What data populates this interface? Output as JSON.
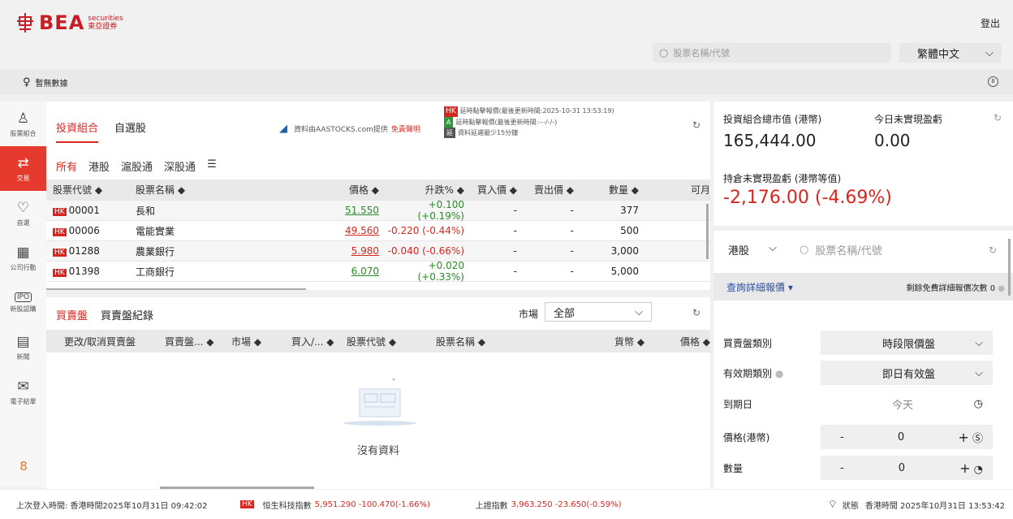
{
  "header": {
    "brand": "BEA",
    "brand_sub_en": "securities",
    "brand_sub_zh": "東亞證券",
    "logout": "登出",
    "search_placeholder": "股票名稱/代號",
    "language": "繁體中文"
  },
  "notice": {
    "text": "暫無數據"
  },
  "sidebar": {
    "items": [
      {
        "label": "股票組合",
        "icon": "person-icon"
      },
      {
        "label": "交易",
        "icon": "swap-arrows-icon"
      },
      {
        "label": "自選",
        "icon": "heart-icon"
      },
      {
        "label": "公司行動",
        "icon": "building-icon"
      },
      {
        "label": "新股認購",
        "icon": "ipo-icon"
      },
      {
        "label": "新聞",
        "icon": "news-icon"
      },
      {
        "label": "電子結單",
        "icon": "statement-icon"
      }
    ],
    "badge": "8"
  },
  "portfolio": {
    "tabs": [
      "投資組合",
      "自選股"
    ],
    "source": "資料由AASTOCKS.com提供",
    "disclaimer": "免責聲明",
    "delay_lines": [
      {
        "tag": "HK",
        "text": "延時點擊報價(最後更新時間:2025-10-31 13:53:19)"
      },
      {
        "tag": "A",
        "text": "延時點擊報價(最後更新時間:---/-/-)"
      },
      {
        "tag": "延",
        "text": "資料延遲最少15分鐘"
      }
    ],
    "market_tabs": [
      "所有",
      "港股",
      "滬股通",
      "深股通"
    ],
    "columns": [
      "股票代號 ◆",
      "股票名稱 ◆",
      "價格 ◆",
      "升跌% ◆",
      "買入價 ◆",
      "賣出價 ◆",
      "數量 ◆",
      "可月"
    ],
    "rows": [
      {
        "market": "HK",
        "code": "00001",
        "name": "長和",
        "price": "51.550",
        "change": "+0.100 (+0.19%)",
        "bid": "-",
        "ask": "-",
        "qty": "377",
        "dir": "up"
      },
      {
        "market": "HK",
        "code": "00006",
        "name": "電能實業",
        "price": "49.560",
        "change": "-0.220 (-0.44%)",
        "bid": "-",
        "ask": "-",
        "qty": "500",
        "dir": "dn"
      },
      {
        "market": "HK",
        "code": "01288",
        "name": "農業銀行",
        "price": "5.980",
        "change": "-0.040 (-0.66%)",
        "bid": "-",
        "ask": "-",
        "qty": "3,000",
        "dir": "dn"
      },
      {
        "market": "HK",
        "code": "01398",
        "name": "工商銀行",
        "price": "6.070",
        "change": "+0.020 (+0.33%)",
        "bid": "-",
        "ask": "-",
        "qty": "5,000",
        "dir": "up"
      }
    ]
  },
  "orders": {
    "tabs": [
      "買賣盤",
      "買賣盤紀錄"
    ],
    "market_label": "市場",
    "market_value": "全部",
    "columns": [
      "更改/取消買賣盤",
      "買賣盤... ◆",
      "市場 ◆",
      "買入/... ◆",
      "股票代號 ◆",
      "股票名稱 ◆",
      "貨幣 ◆",
      "價格 ◆"
    ],
    "empty_text": "沒有資料"
  },
  "summary": {
    "total_label": "投資組合總市值 (港幣)",
    "total_value": "165,444.00",
    "today_label": "今日未實現盈虧",
    "today_value": "0.00",
    "unreal_label": "持倉未實現盈虧 (港幣等值)",
    "unreal_value": "-2,176.00 (-4.69%)"
  },
  "trade": {
    "market": "港股",
    "search_placeholder": "股票名稱/代號",
    "quote_link": "查詢詳細報價",
    "quote_remaining": "剩餘免費詳細報價次數 0",
    "order_type_label": "買賣盤類別",
    "order_type_value": "時段限價盤",
    "validity_label": "有效期類別",
    "validity_value": "即日有效盤",
    "expiry_label": "到期日",
    "expiry_value": "今天",
    "price_label": "價格(港幣)",
    "price_value": "0",
    "qty_label": "數量",
    "qty_value": "0"
  },
  "status": {
    "last_login": "上次登入時間: 香港時間2025年10月31日 09:42:02",
    "idx1_tag": "HK",
    "idx1_name": "恒生科技指數",
    "idx1_value": "5,951.290 -100.470(-1.66%)",
    "idx2_name": "上證指數",
    "idx2_value": "3,963.250 -23.650(-0.59%)",
    "status_label": "狀態",
    "time": "香港時間 2025年10月31日 13:53:42"
  }
}
